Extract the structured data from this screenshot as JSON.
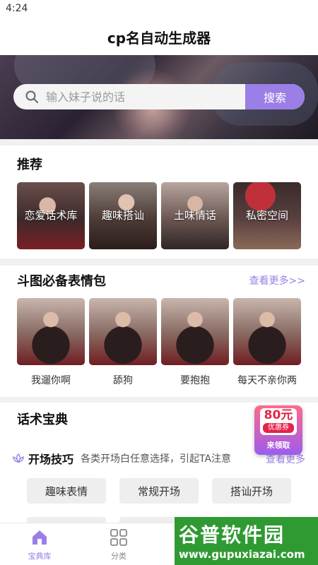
{
  "status": {
    "time": "4:24"
  },
  "header": {
    "title": "cp名自动生成器"
  },
  "search": {
    "placeholder": "输入妹子说的话",
    "button_label": "搜索"
  },
  "recommend": {
    "title": "推荐",
    "items": [
      {
        "label": "恋爱话术库"
      },
      {
        "label": "趣味搭讪"
      },
      {
        "label": "土味情话"
      },
      {
        "label": "私密空间"
      }
    ]
  },
  "memes": {
    "title": "斗图必备表情包",
    "more_label": "查看更多>>",
    "items": [
      {
        "caption": "我遛你啊"
      },
      {
        "caption": "舔狗"
      },
      {
        "caption": "要抱抱"
      },
      {
        "caption": "每天不亲你两"
      }
    ]
  },
  "tips": {
    "title": "话术宝典",
    "sub_title": "开场技巧",
    "sub_desc": "各类开场白任意选择，引起TA注意",
    "more_label": "查看更多",
    "chips": [
      {
        "label": "趣味表情"
      },
      {
        "label": "常规开场"
      },
      {
        "label": "搭讪开场"
      }
    ]
  },
  "coupon": {
    "amount": "80元",
    "sub": "优惠券",
    "action": "来领取"
  },
  "tabbar": {
    "tabs": [
      {
        "label": "宝典库"
      },
      {
        "label": "分类"
      }
    ]
  },
  "watermark": {
    "main": "谷普软件园",
    "sub": "www.gupuxiazai.com"
  },
  "colors": {
    "accent": "#9b7fe6",
    "background": "#f1f1f1"
  }
}
